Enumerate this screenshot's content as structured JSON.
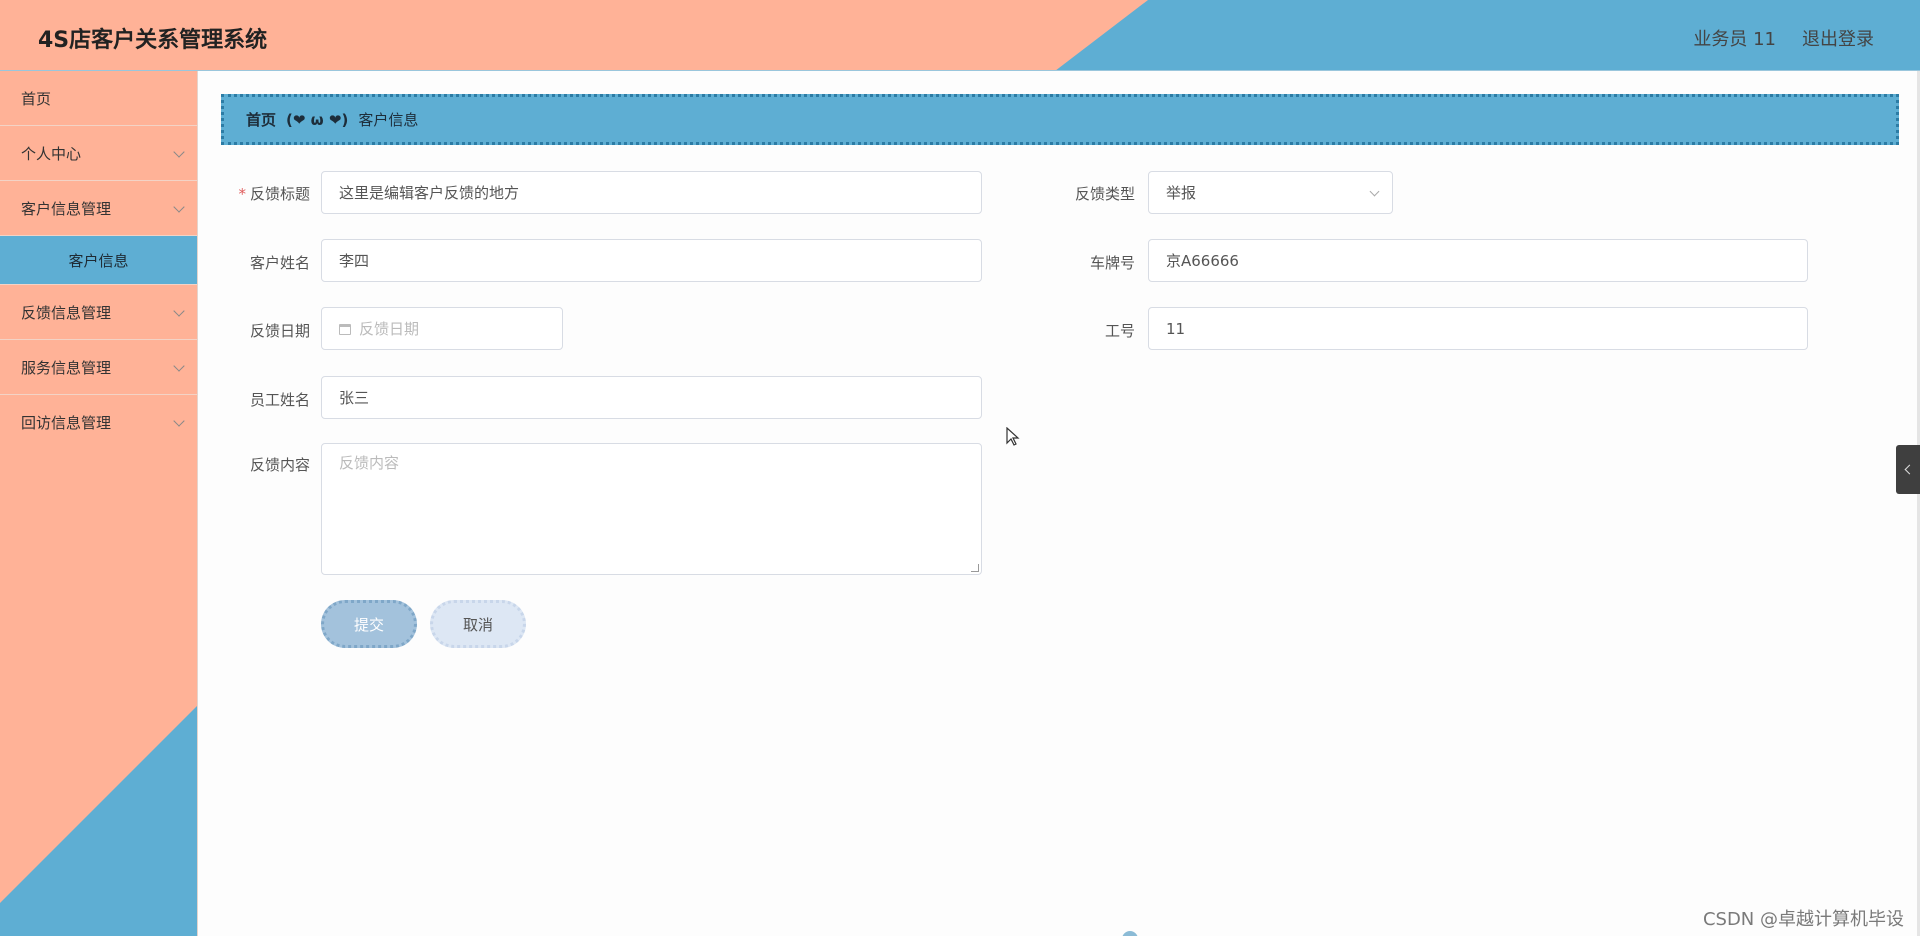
{
  "header": {
    "title": "4S店客户关系管理系统",
    "user_label": "业务员 11",
    "logout_label": "退出登录"
  },
  "sidebar": {
    "items": [
      {
        "label": "首页",
        "has_chevron": false
      },
      {
        "label": "个人中心",
        "has_chevron": true
      },
      {
        "label": "客户信息管理",
        "has_chevron": true
      },
      {
        "label": "客户信息",
        "sub": true,
        "active": true
      },
      {
        "label": "反馈信息管理",
        "has_chevron": true
      },
      {
        "label": "服务信息管理",
        "has_chevron": true
      },
      {
        "label": "回访信息管理",
        "has_chevron": true
      }
    ]
  },
  "breadcrumb": {
    "home": "首页",
    "separator": "(❤ ω ❤)",
    "current": "客户信息"
  },
  "form": {
    "feedback_title": {
      "label": "反馈标题",
      "required_mark": "*",
      "value": "这里是编辑客户反馈的地方"
    },
    "feedback_type": {
      "label": "反馈类型",
      "value": "举报"
    },
    "customer_name": {
      "label": "客户姓名",
      "value": "李四"
    },
    "plate_number": {
      "label": "车牌号",
      "value": "京A66666"
    },
    "feedback_date": {
      "label": "反馈日期",
      "placeholder": "反馈日期"
    },
    "job_number": {
      "label": "工号",
      "value": "11"
    },
    "employee_name": {
      "label": "员工姓名",
      "value": "张三"
    },
    "feedback_content": {
      "label": "反馈内容",
      "placeholder": "反馈内容"
    },
    "submit_label": "提交",
    "cancel_label": "取消"
  },
  "watermark": "CSDN @卓越计算机毕设",
  "colors": {
    "peach": "#ffb297",
    "blue": "#5eaed3",
    "submit_bg": "#a3c2dc",
    "cancel_bg": "#dde7f4"
  }
}
